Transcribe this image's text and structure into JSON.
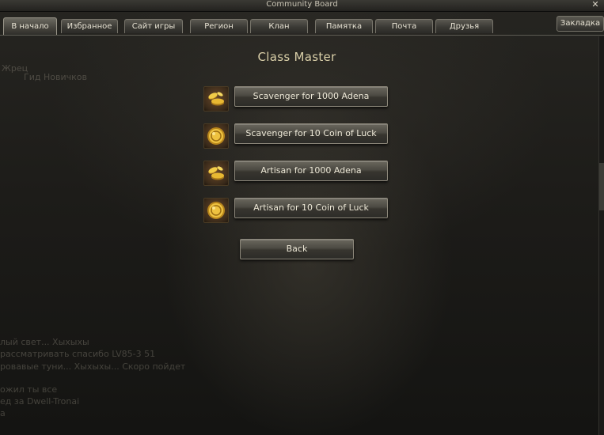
{
  "window": {
    "title": "Community Board",
    "close_symbol": "✕"
  },
  "tabs": [
    {
      "label": "В начало",
      "active": true
    },
    {
      "label": "Избранное"
    },
    {
      "label": "Сайт игры"
    },
    {
      "label": "Регион"
    },
    {
      "label": "Клан"
    },
    {
      "label": "Памятка"
    },
    {
      "label": "Почта"
    },
    {
      "label": "Друзья"
    }
  ],
  "bookmark_tab": {
    "label": "Закладка"
  },
  "background_ghost_text": {
    "top": [
      "Жрец",
      "Гид Новичков"
    ],
    "bottom": [
      "лый свет... Хыхыхы",
      "рассматривать спасибо LV85-3 51",
      "ровавые туни... Хыхыхы... Скоро пойдет",
      "ожил ты все",
      "ед за Dwell-Tronai",
      "а"
    ]
  },
  "page": {
    "title": "Class Master",
    "options": [
      {
        "label": "Scavenger for 1000 Adena",
        "icon": "adena-icon"
      },
      {
        "label": "Scavenger for 10 Coin of Luck",
        "icon": "coin-of-luck-icon"
      },
      {
        "label": "Artisan for 1000 Adena",
        "icon": "adena-icon"
      },
      {
        "label": "Artisan for 10 Coin of Luck",
        "icon": "coin-of-luck-icon"
      }
    ],
    "back_label": "Back"
  },
  "colors": {
    "accent_gold": "#d9cfa8",
    "button_border": "#8c877a",
    "background": "#1d1c19"
  }
}
